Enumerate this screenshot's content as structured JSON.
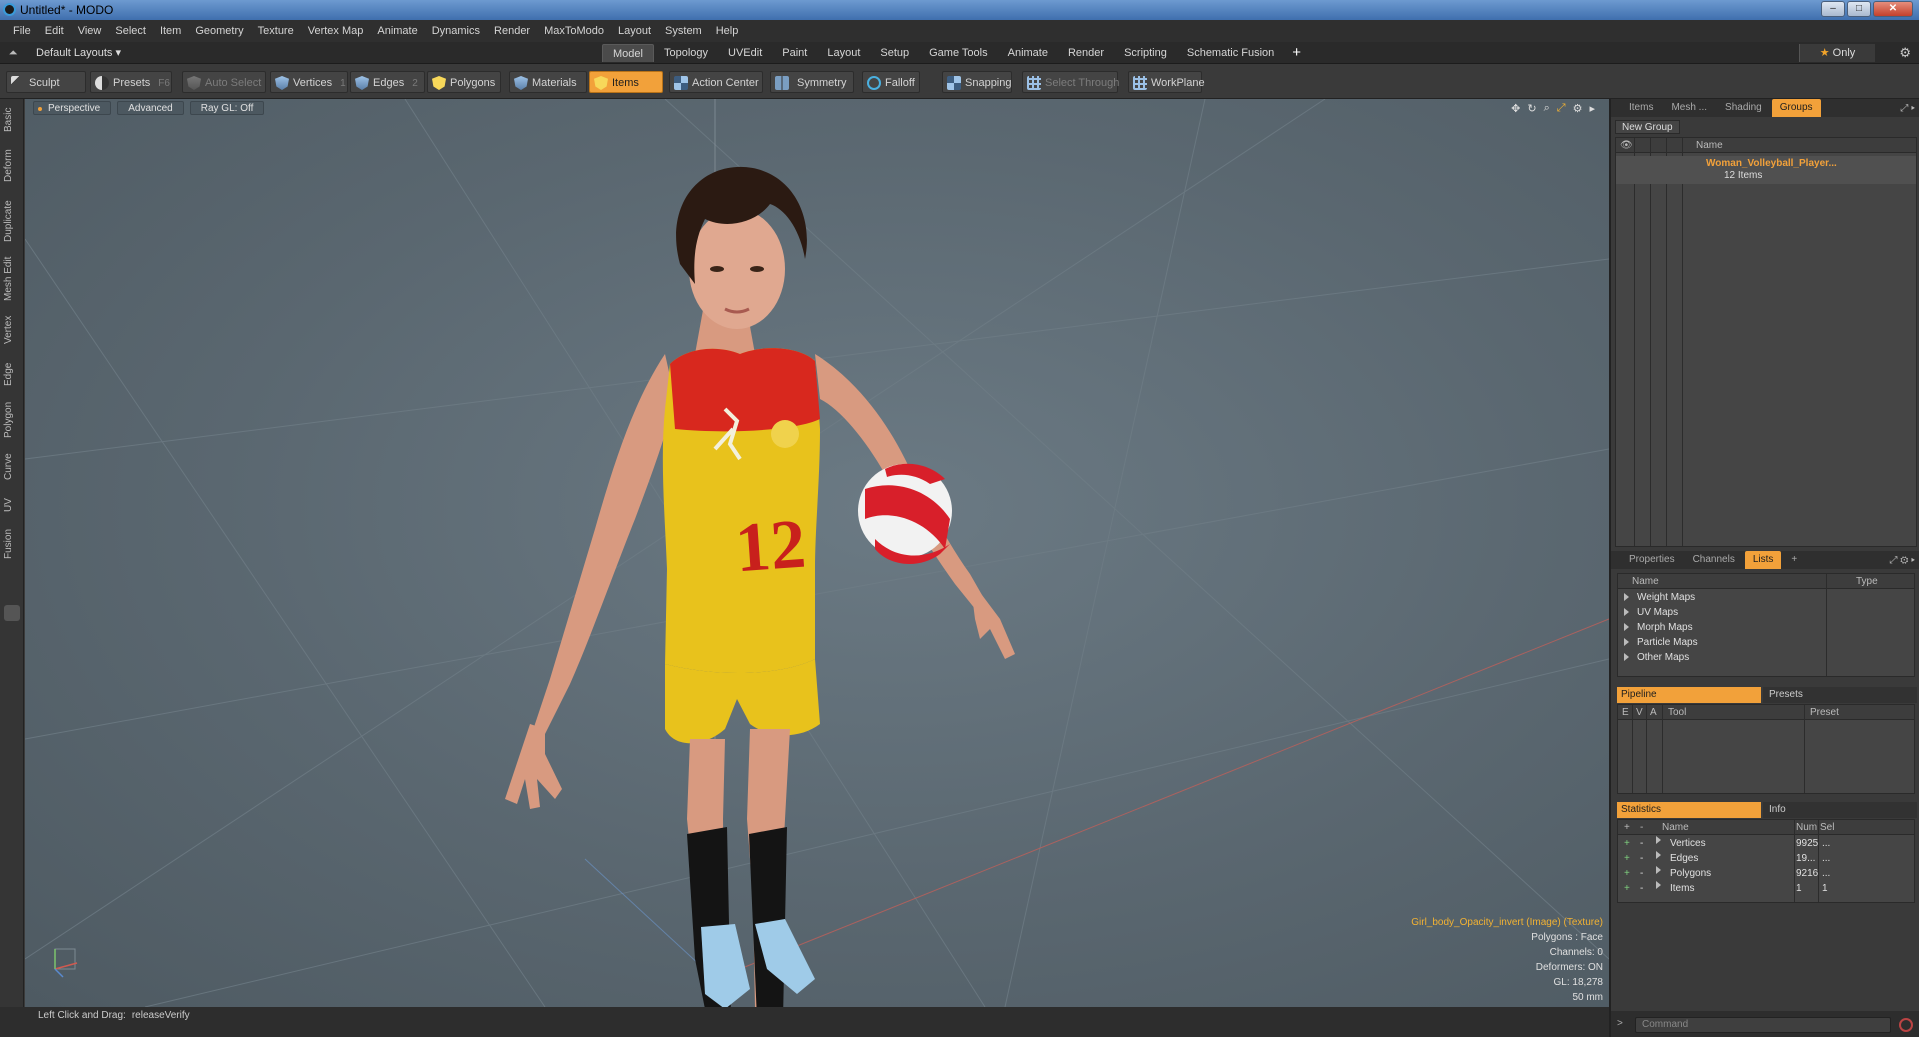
{
  "window": {
    "title": "Untitled* - MODO"
  },
  "menu": [
    "File",
    "Edit",
    "View",
    "Select",
    "Item",
    "Geometry",
    "Texture",
    "Vertex Map",
    "Animate",
    "Dynamics",
    "Render",
    "MaxToModo",
    "Layout",
    "System",
    "Help"
  ],
  "layout_row": {
    "layout_selector": "Default Layouts ▾",
    "tabs": [
      "Model",
      "Topology",
      "UVEdit",
      "Paint",
      "Layout",
      "Setup",
      "Game Tools",
      "Animate",
      "Render",
      "Scripting",
      "Schematic Fusion"
    ],
    "active_tab": "Model",
    "add_tab": "+",
    "only_label": "Only"
  },
  "toolbar": {
    "sculpt": "Sculpt",
    "presets": "Presets",
    "presets_hotkey": "F6",
    "auto_select": "Auto Select",
    "vertices": "Vertices",
    "vertices_hotkey": "1",
    "edges": "Edges",
    "edges_hotkey": "2",
    "polygons": "Polygons",
    "materials": "Materials",
    "items": "Items",
    "action_center": "Action Center",
    "symmetry": "Symmetry",
    "falloff": "Falloff",
    "snapping": "Snapping",
    "select_through": "Select Through",
    "workplane": "WorkPlane"
  },
  "left_strip": [
    "Basic",
    "Deform",
    "Duplicate",
    "Mesh Edit",
    "Vertex",
    "Edge",
    "Polygon",
    "Curve",
    "UV",
    "Fusion"
  ],
  "viewport": {
    "view_mode": "Perspective",
    "shading": "Advanced",
    "raygl": "Ray GL: Off",
    "info": {
      "texture": "Girl_body_Opacity_invert (Image) (Texture)",
      "polygons": "Polygons : Face",
      "channels": "Channels: 0",
      "deformers": "Deformers: ON",
      "gl": "GL: 18,278",
      "focal": "50 mm"
    },
    "jersey_number": "12"
  },
  "status": {
    "hint": "Left Click and Drag:",
    "value": "releaseVerify"
  },
  "groups_panel": {
    "tabs": [
      "Items",
      "Mesh ...",
      "Shading",
      "Groups"
    ],
    "active_tab": "Groups",
    "new_group": "New Group",
    "name_header": "Name",
    "item_name": "Woman_Volleyball_Player...",
    "item_count": "12 Items"
  },
  "lists_panel": {
    "tabs": [
      "Properties",
      "Channels",
      "Lists"
    ],
    "active_tab": "Lists",
    "add": "+",
    "headers": {
      "name": "Name",
      "type": "Type"
    },
    "rows": [
      "Weight Maps",
      "UV Maps",
      "Morph Maps",
      "Particle Maps",
      "Other Maps"
    ]
  },
  "pipeline_panel": {
    "tab_active": "Pipeline",
    "tab_other": "Presets",
    "headers": {
      "e": "E",
      "v": "V",
      "a": "A",
      "tool": "Tool",
      "preset": "Preset"
    }
  },
  "statistics_panel": {
    "tab_active": "Statistics",
    "tab_other": "Info",
    "headers": {
      "plus": "+",
      "minus": "-",
      "name": "Name",
      "num": "Num",
      "sel": "Sel"
    },
    "rows": [
      {
        "name": "Vertices",
        "num": "9925",
        "sel": "..."
      },
      {
        "name": "Edges",
        "num": "19...",
        "sel": "..."
      },
      {
        "name": "Polygons",
        "num": "9216",
        "sel": "..."
      },
      {
        "name": "Items",
        "num": "1",
        "sel": "1"
      }
    ]
  },
  "command": {
    "placeholder": "Command"
  },
  "colors": {
    "accent": "#f2a13a",
    "jersey_yellow": "#e8c21c",
    "jersey_red": "#d8281e",
    "group_item": "#f2a13a"
  }
}
